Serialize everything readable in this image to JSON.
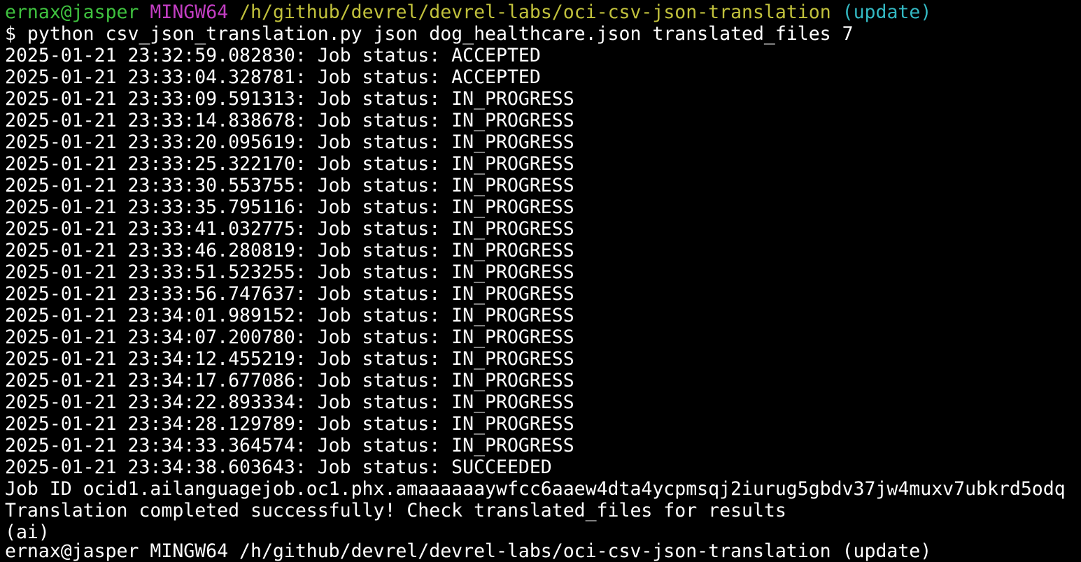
{
  "prompt": {
    "user_host": "ernax@jasper",
    "system": "MINGW64",
    "path": "/h/github/devrel/devrel-labs/oci-csv-json-translation",
    "branch": "(update)"
  },
  "command": "$ python csv_json_translation.py json dog_healthcare.json translated_files 7",
  "log_lines": [
    "2025-01-21 23:32:59.082830: Job status: ACCEPTED",
    "2025-01-21 23:33:04.328781: Job status: ACCEPTED",
    "2025-01-21 23:33:09.591313: Job status: IN_PROGRESS",
    "2025-01-21 23:33:14.838678: Job status: IN_PROGRESS",
    "2025-01-21 23:33:20.095619: Job status: IN_PROGRESS",
    "2025-01-21 23:33:25.322170: Job status: IN_PROGRESS",
    "2025-01-21 23:33:30.553755: Job status: IN_PROGRESS",
    "2025-01-21 23:33:35.795116: Job status: IN_PROGRESS",
    "2025-01-21 23:33:41.032775: Job status: IN_PROGRESS",
    "2025-01-21 23:33:46.280819: Job status: IN_PROGRESS",
    "2025-01-21 23:33:51.523255: Job status: IN_PROGRESS",
    "2025-01-21 23:33:56.747637: Job status: IN_PROGRESS",
    "2025-01-21 23:34:01.989152: Job status: IN_PROGRESS",
    "2025-01-21 23:34:07.200780: Job status: IN_PROGRESS",
    "2025-01-21 23:34:12.455219: Job status: IN_PROGRESS",
    "2025-01-21 23:34:17.677086: Job status: IN_PROGRESS",
    "2025-01-21 23:34:22.893334: Job status: IN_PROGRESS",
    "2025-01-21 23:34:28.129789: Job status: IN_PROGRESS",
    "2025-01-21 23:34:33.364574: Job status: IN_PROGRESS",
    "2025-01-21 23:34:38.603643: Job status: SUCCEEDED"
  ],
  "job_id_line": "Job ID ocid1.ailanguagejob.oc1.phx.amaaaaaaywfcc6aaew4dta4ycpmsqj2iurug5gbdv37jw4muxv7ubkrd5odq",
  "completion_line": "Translation completed successfully! Check translated_files for results",
  "env_line": "(ai)",
  "partial_next_line": "ernax@jasper MINGW64 /h/github/devrel/devrel-labs/oci-csv-json-translation (update)",
  "colors": {
    "background": "#000000",
    "text": "#ffffff",
    "user_host": "#3fc23f",
    "system": "#c33ec3",
    "path": "#c1c13c",
    "branch": "#33b8c2"
  }
}
